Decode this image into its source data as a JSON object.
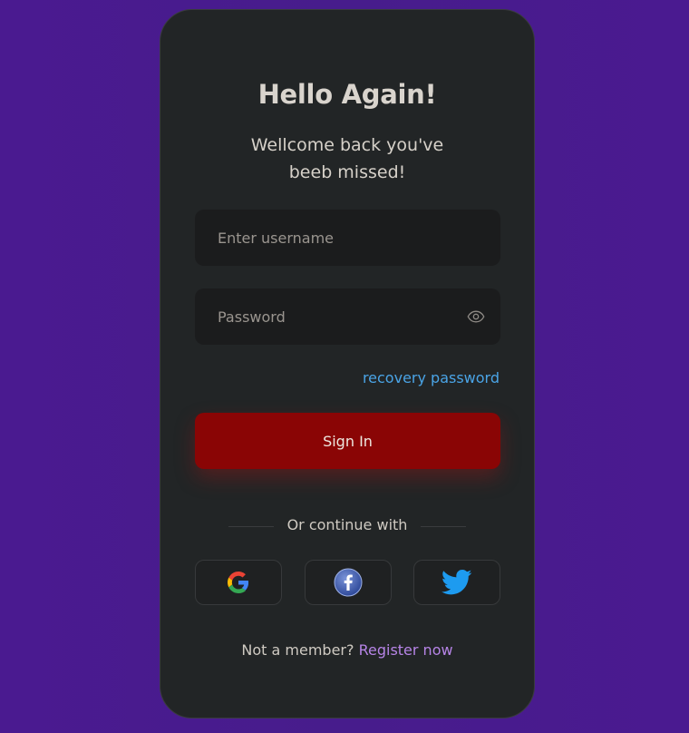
{
  "login": {
    "title": "Hello Again!",
    "subtitle_line1": "Wellcome back you've",
    "subtitle_line2": "beeb missed!",
    "username_placeholder": "Enter username",
    "password_placeholder": "Password",
    "recovery_link": "recovery password",
    "sign_in_label": "Sign In",
    "divider_text": "Or continue with",
    "social": [
      {
        "name": "google",
        "icon": "google-icon"
      },
      {
        "name": "facebook",
        "icon": "facebook-icon"
      },
      {
        "name": "twitter",
        "icon": "twitter-icon"
      }
    ],
    "footer_text": "Not a member?",
    "register_link": "Register now"
  },
  "colors": {
    "background": "#4a1a90",
    "card": "#222526",
    "sign_in_button": "#8a0505",
    "recovery_link": "#4aa4e6",
    "register_link": "#b684e6"
  }
}
